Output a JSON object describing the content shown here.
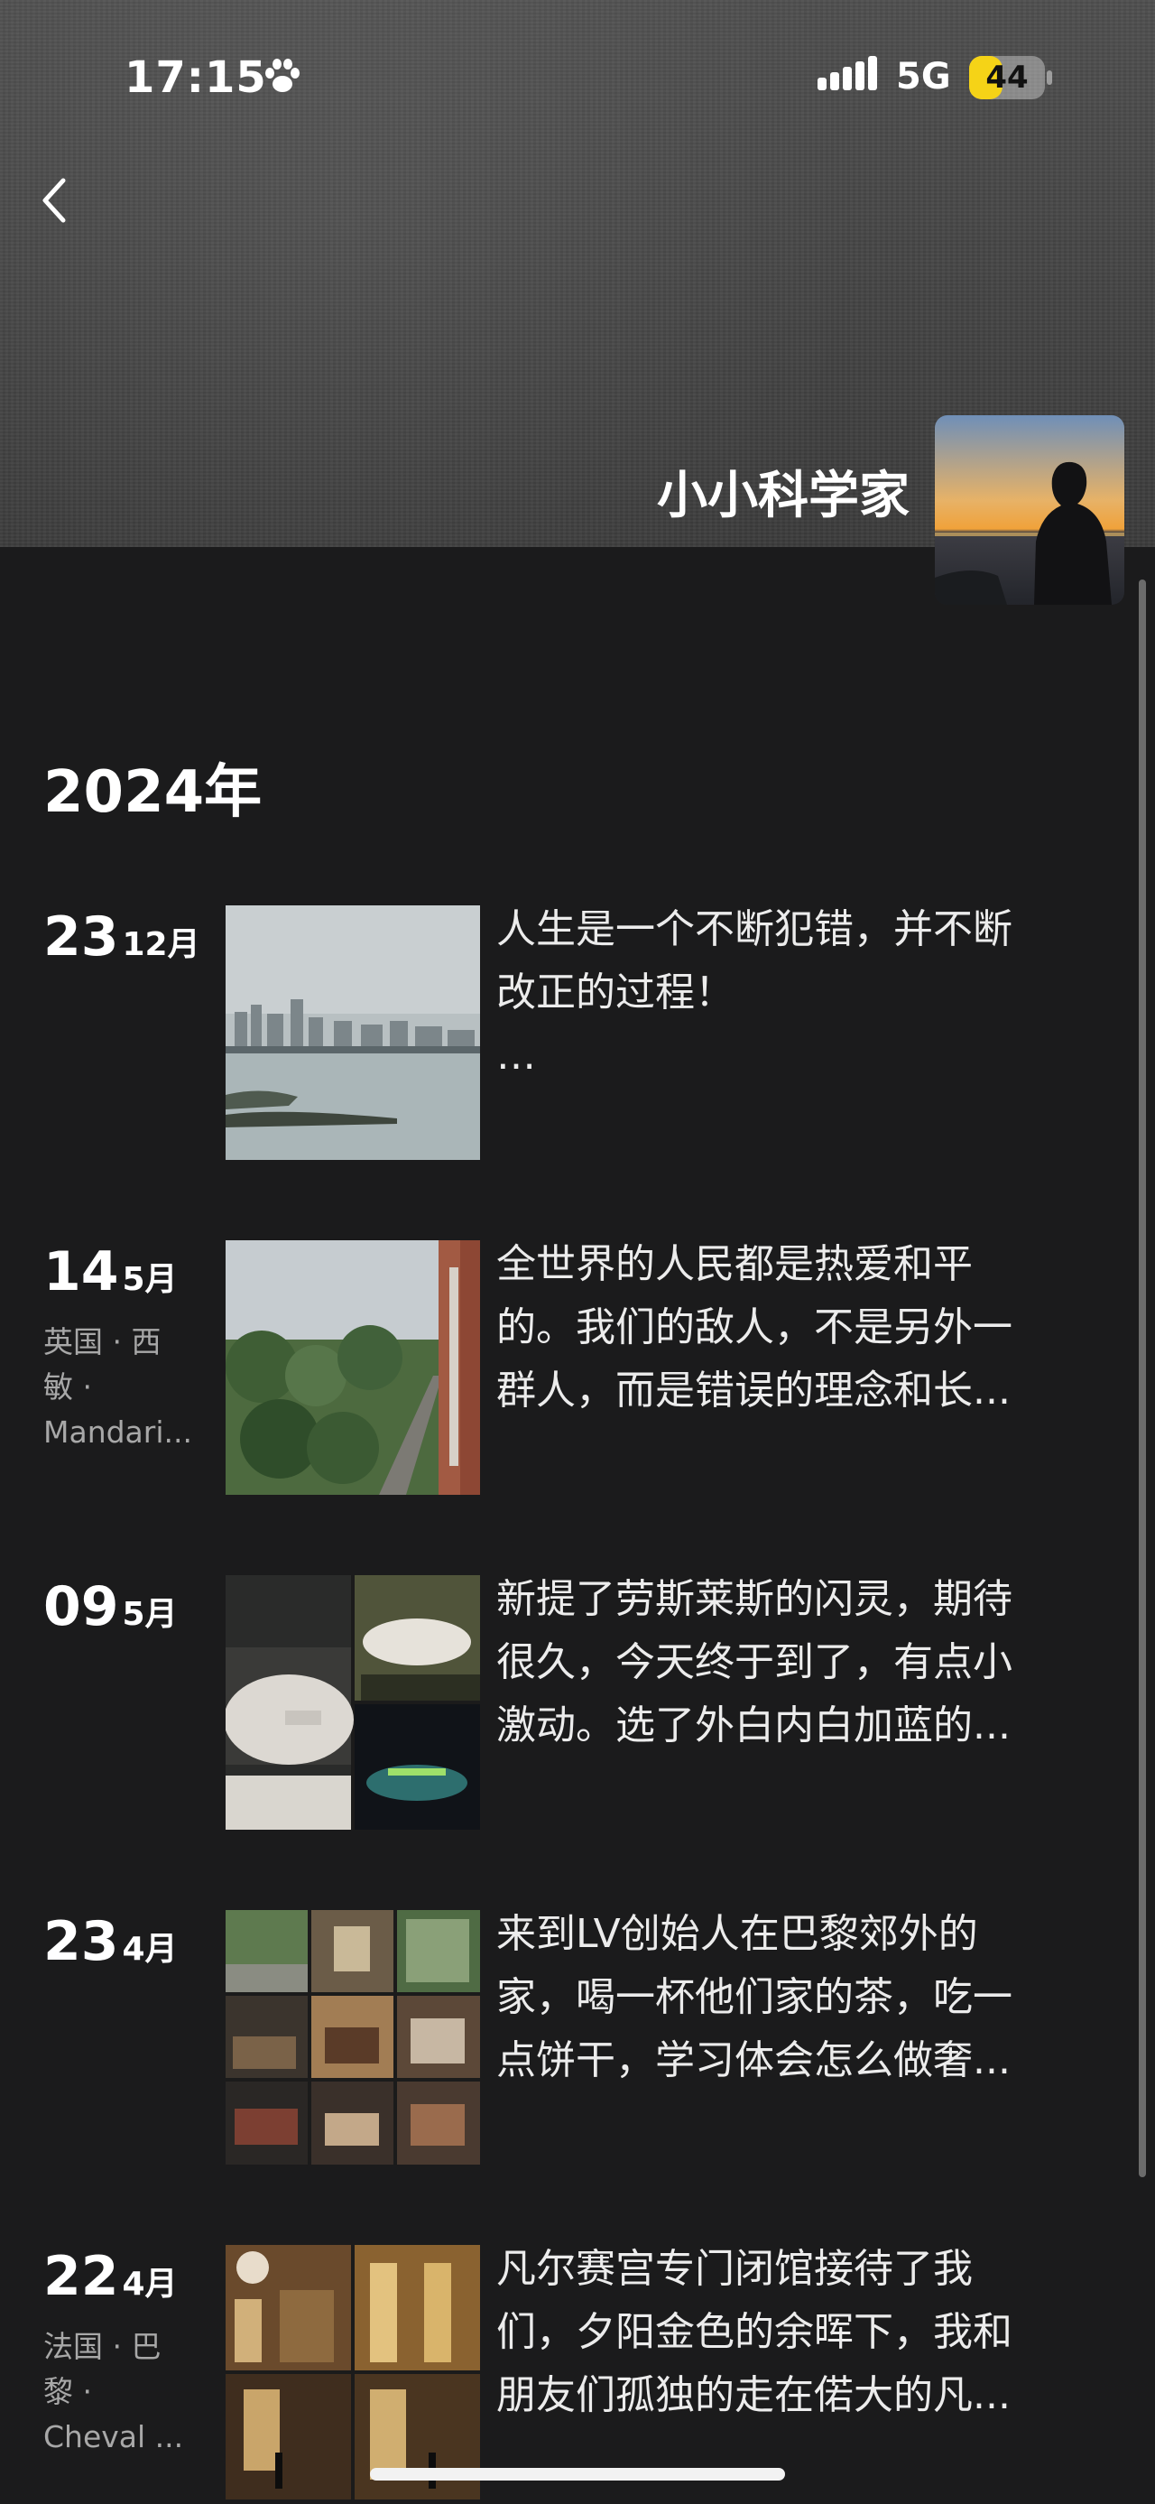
{
  "status_bar": {
    "time": "17:15",
    "network": "5G",
    "battery": "44",
    "battery_level": 0.44
  },
  "header": {
    "name": "小小科学家"
  },
  "timeline": {
    "year": "2024年",
    "posts": [
      {
        "day": "23",
        "month": "12月",
        "location": [],
        "text": [
          "人生是一个不断犯错，并不断",
          "改正的过程！",
          "…"
        ]
      },
      {
        "day": "14",
        "month": "5月",
        "location": [
          "英国 · 西",
          "敏 ·",
          "Mandari..."
        ],
        "text": [
          "全世界的人民都是热爱和平",
          "的。我们的敌人，不是另外一",
          "群人，而是错误的理念和长..."
        ]
      },
      {
        "day": "09",
        "month": "5月",
        "location": [],
        "text": [
          "新提了劳斯莱斯的闪灵，期待",
          "很久，今天终于到了，有点小",
          "激动。选了外白内白加蓝的..."
        ]
      },
      {
        "day": "23",
        "month": "4月",
        "location": [],
        "text": [
          "来到LV创始人在巴黎郊外的",
          "家，喝一杯他们家的茶，吃一",
          "点饼干，学习体会怎么做奢..."
        ]
      },
      {
        "day": "22",
        "month": "4月",
        "location": [
          "法国 · 巴",
          "黎 ·",
          "Cheval ..."
        ],
        "text": [
          "凡尔赛宫专门闭馆接待了我",
          "们，夕阳金色的余晖下，我和",
          "朋友们孤独的走在偌大的凡..."
        ]
      }
    ]
  }
}
